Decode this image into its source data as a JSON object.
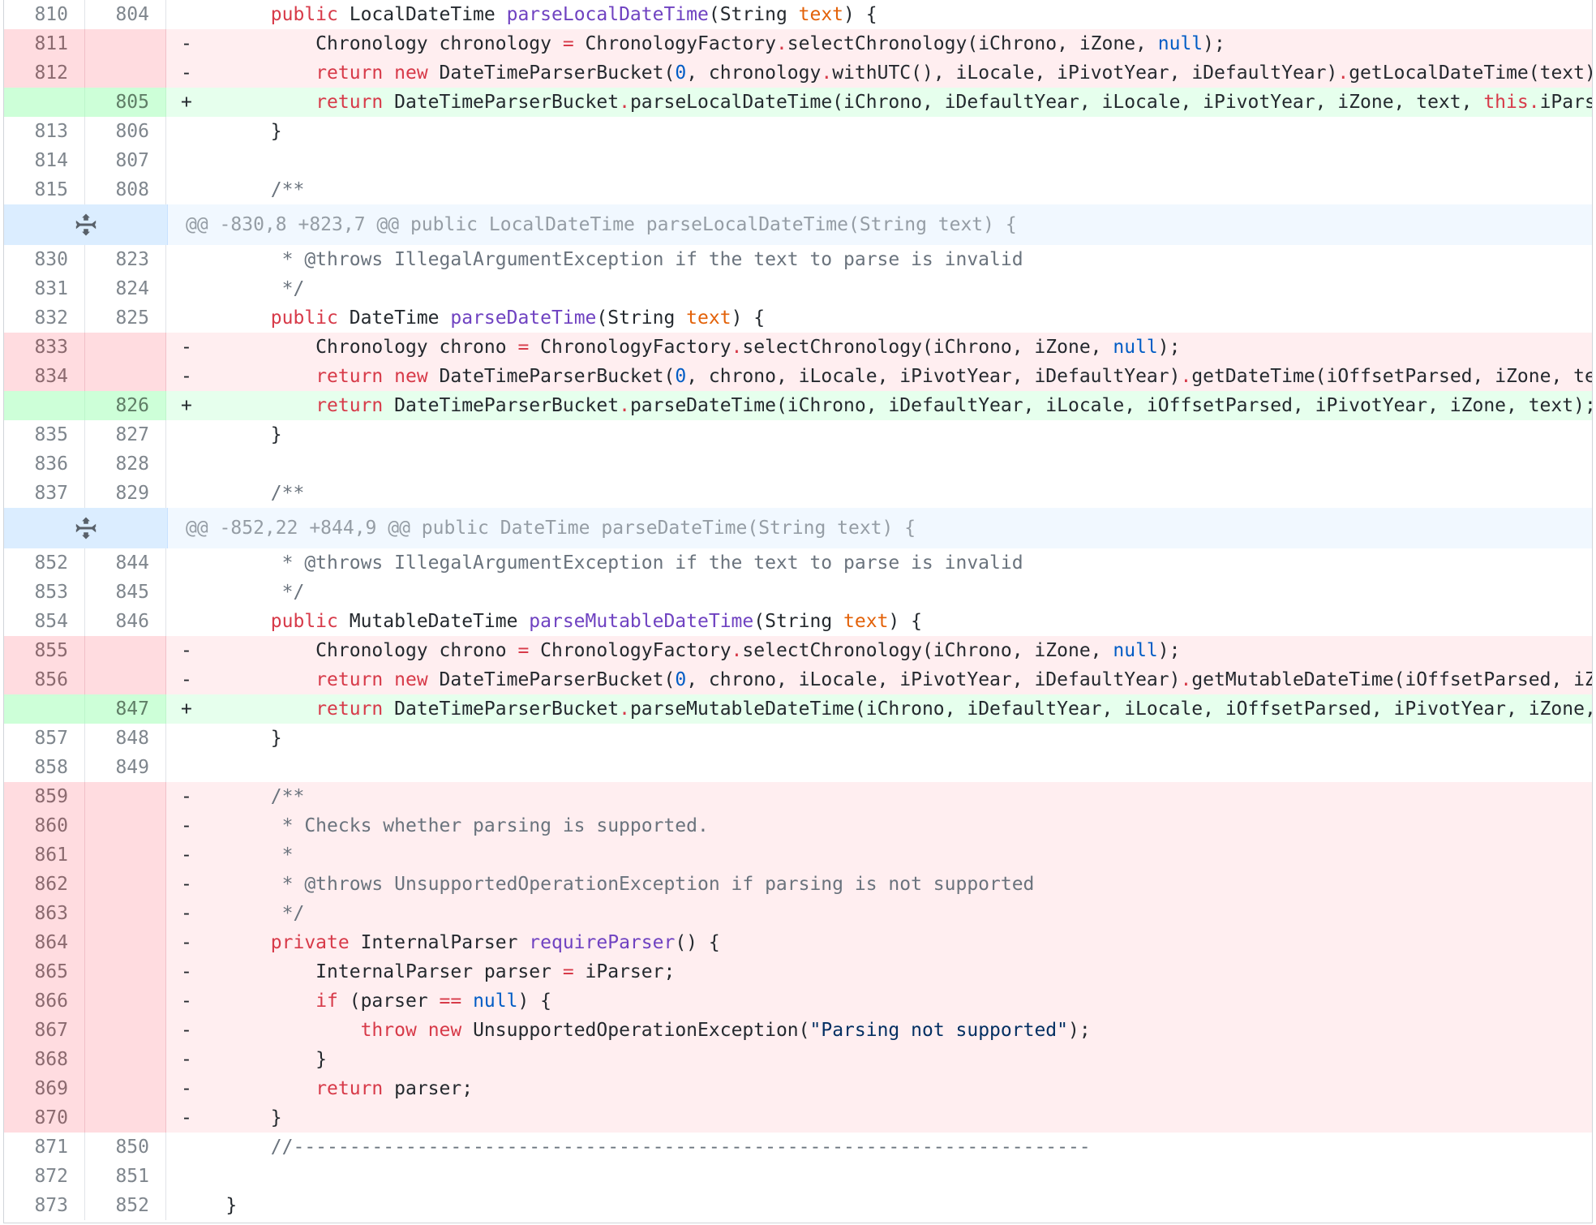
{
  "rows": [
    {
      "type": "ctx",
      "old": "810",
      "new": "804",
      "sign": " ",
      "tokens": [
        [
          "t",
          "    "
        ],
        [
          "k",
          "public"
        ],
        [
          "t",
          " LocalDateTime "
        ],
        [
          "f",
          "parseLocalDateTime"
        ],
        [
          "t",
          "(String "
        ],
        [
          "v",
          "text"
        ],
        [
          "t",
          ") {"
        ]
      ]
    },
    {
      "type": "del",
      "old": "811",
      "new": "",
      "sign": "-",
      "tokens": [
        [
          "t",
          "        Chronology chronology "
        ],
        [
          "k",
          "="
        ],
        [
          "t",
          " ChronologyFactory"
        ],
        [
          "k",
          "."
        ],
        [
          "t",
          "selectChronology(iChrono, iZone, "
        ],
        [
          "n",
          "null"
        ],
        [
          "t",
          ");"
        ]
      ]
    },
    {
      "type": "del",
      "old": "812",
      "new": "",
      "sign": "-",
      "tokens": [
        [
          "t",
          "        "
        ],
        [
          "k",
          "return"
        ],
        [
          "t",
          " "
        ],
        [
          "k",
          "new"
        ],
        [
          "t",
          " DateTimeParserBucket("
        ],
        [
          "n",
          "0"
        ],
        [
          "t",
          ", chronology"
        ],
        [
          "k",
          "."
        ],
        [
          "t",
          "withUTC(), iLocale, iPivotYear, iDefaultYear)"
        ],
        [
          "k",
          "."
        ],
        [
          "t",
          "getLocalDateTime(text);"
        ]
      ]
    },
    {
      "type": "add",
      "old": "",
      "new": "805",
      "sign": "+",
      "tokens": [
        [
          "t",
          "        "
        ],
        [
          "k",
          "return"
        ],
        [
          "t",
          " DateTimeParserBucket"
        ],
        [
          "k",
          "."
        ],
        [
          "t",
          "parseLocalDateTime(iChrono, iDefaultYear, iLocale, iPivotYear, iZone, text, "
        ],
        [
          "k",
          "this"
        ],
        [
          "k",
          "."
        ],
        [
          "t",
          "iParser);"
        ]
      ]
    },
    {
      "type": "ctx",
      "old": "813",
      "new": "806",
      "sign": " ",
      "tokens": [
        [
          "t",
          "    }"
        ]
      ]
    },
    {
      "type": "ctx",
      "old": "814",
      "new": "807",
      "sign": " ",
      "tokens": [
        [
          "t",
          ""
        ]
      ]
    },
    {
      "type": "ctx",
      "old": "815",
      "new": "808",
      "sign": " ",
      "tokens": [
        [
          "t",
          "    "
        ],
        [
          "c",
          "/**"
        ]
      ]
    },
    {
      "type": "hunk",
      "text": "@@ -830,8 +823,7 @@ public LocalDateTime parseLocalDateTime(String text) {"
    },
    {
      "type": "ctx",
      "old": "830",
      "new": "823",
      "sign": " ",
      "tokens": [
        [
          "c",
          "     * @throws IllegalArgumentException if the text to parse is invalid"
        ]
      ]
    },
    {
      "type": "ctx",
      "old": "831",
      "new": "824",
      "sign": " ",
      "tokens": [
        [
          "c",
          "     */"
        ]
      ]
    },
    {
      "type": "ctx",
      "old": "832",
      "new": "825",
      "sign": " ",
      "tokens": [
        [
          "t",
          "    "
        ],
        [
          "k",
          "public"
        ],
        [
          "t",
          " DateTime "
        ],
        [
          "f",
          "parseDateTime"
        ],
        [
          "t",
          "(String "
        ],
        [
          "v",
          "text"
        ],
        [
          "t",
          ") {"
        ]
      ]
    },
    {
      "type": "del",
      "old": "833",
      "new": "",
      "sign": "-",
      "tokens": [
        [
          "t",
          "        Chronology chrono "
        ],
        [
          "k",
          "="
        ],
        [
          "t",
          " ChronologyFactory"
        ],
        [
          "k",
          "."
        ],
        [
          "t",
          "selectChronology(iChrono, iZone, "
        ],
        [
          "n",
          "null"
        ],
        [
          "t",
          ");"
        ]
      ]
    },
    {
      "type": "del",
      "old": "834",
      "new": "",
      "sign": "-",
      "tokens": [
        [
          "t",
          "        "
        ],
        [
          "k",
          "return"
        ],
        [
          "t",
          " "
        ],
        [
          "k",
          "new"
        ],
        [
          "t",
          " DateTimeParserBucket("
        ],
        [
          "n",
          "0"
        ],
        [
          "t",
          ", chrono, iLocale, iPivotYear, iDefaultYear)"
        ],
        [
          "k",
          "."
        ],
        [
          "t",
          "getDateTime(iOffsetParsed, iZone, text);"
        ]
      ]
    },
    {
      "type": "add",
      "old": "",
      "new": "826",
      "sign": "+",
      "tokens": [
        [
          "t",
          "        "
        ],
        [
          "k",
          "return"
        ],
        [
          "t",
          " DateTimeParserBucket"
        ],
        [
          "k",
          "."
        ],
        [
          "t",
          "parseDateTime(iChrono, iDefaultYear, iLocale, iOffsetParsed, iPivotYear, iZone, text);"
        ]
      ]
    },
    {
      "type": "ctx",
      "old": "835",
      "new": "827",
      "sign": " ",
      "tokens": [
        [
          "t",
          "    }"
        ]
      ]
    },
    {
      "type": "ctx",
      "old": "836",
      "new": "828",
      "sign": " ",
      "tokens": [
        [
          "t",
          ""
        ]
      ]
    },
    {
      "type": "ctx",
      "old": "837",
      "new": "829",
      "sign": " ",
      "tokens": [
        [
          "t",
          "    "
        ],
        [
          "c",
          "/**"
        ]
      ]
    },
    {
      "type": "hunk",
      "text": "@@ -852,22 +844,9 @@ public DateTime parseDateTime(String text) {"
    },
    {
      "type": "ctx",
      "old": "852",
      "new": "844",
      "sign": " ",
      "tokens": [
        [
          "c",
          "     * @throws IllegalArgumentException if the text to parse is invalid"
        ]
      ]
    },
    {
      "type": "ctx",
      "old": "853",
      "new": "845",
      "sign": " ",
      "tokens": [
        [
          "c",
          "     */"
        ]
      ]
    },
    {
      "type": "ctx",
      "old": "854",
      "new": "846",
      "sign": " ",
      "tokens": [
        [
          "t",
          "    "
        ],
        [
          "k",
          "public"
        ],
        [
          "t",
          " MutableDateTime "
        ],
        [
          "f",
          "parseMutableDateTime"
        ],
        [
          "t",
          "(String "
        ],
        [
          "v",
          "text"
        ],
        [
          "t",
          ") {"
        ]
      ]
    },
    {
      "type": "del",
      "old": "855",
      "new": "",
      "sign": "-",
      "tokens": [
        [
          "t",
          "        Chronology chrono "
        ],
        [
          "k",
          "="
        ],
        [
          "t",
          " ChronologyFactory"
        ],
        [
          "k",
          "."
        ],
        [
          "t",
          "selectChronology(iChrono, iZone, "
        ],
        [
          "n",
          "null"
        ],
        [
          "t",
          ");"
        ]
      ]
    },
    {
      "type": "del",
      "old": "856",
      "new": "",
      "sign": "-",
      "tokens": [
        [
          "t",
          "        "
        ],
        [
          "k",
          "return"
        ],
        [
          "t",
          " "
        ],
        [
          "k",
          "new"
        ],
        [
          "t",
          " DateTimeParserBucket("
        ],
        [
          "n",
          "0"
        ],
        [
          "t",
          ", chrono, iLocale, iPivotYear, iDefaultYear)"
        ],
        [
          "k",
          "."
        ],
        [
          "t",
          "getMutableDateTime(iOffsetParsed, iZone, text);"
        ]
      ]
    },
    {
      "type": "add",
      "old": "",
      "new": "847",
      "sign": "+",
      "tokens": [
        [
          "t",
          "        "
        ],
        [
          "k",
          "return"
        ],
        [
          "t",
          " DateTimeParserBucket"
        ],
        [
          "k",
          "."
        ],
        [
          "t",
          "parseMutableDateTime(iChrono, iDefaultYear, iLocale, iOffsetParsed, iPivotYear, iZone, text);"
        ]
      ]
    },
    {
      "type": "ctx",
      "old": "857",
      "new": "848",
      "sign": " ",
      "tokens": [
        [
          "t",
          "    }"
        ]
      ]
    },
    {
      "type": "ctx",
      "old": "858",
      "new": "849",
      "sign": " ",
      "tokens": [
        [
          "t",
          ""
        ]
      ]
    },
    {
      "type": "del",
      "old": "859",
      "new": "",
      "sign": "-",
      "tokens": [
        [
          "t",
          "    "
        ],
        [
          "c",
          "/**"
        ]
      ]
    },
    {
      "type": "del",
      "old": "860",
      "new": "",
      "sign": "-",
      "tokens": [
        [
          "c",
          "     * Checks whether parsing is supported."
        ]
      ]
    },
    {
      "type": "del",
      "old": "861",
      "new": "",
      "sign": "-",
      "tokens": [
        [
          "c",
          "     *"
        ]
      ]
    },
    {
      "type": "del",
      "old": "862",
      "new": "",
      "sign": "-",
      "tokens": [
        [
          "c",
          "     * @throws UnsupportedOperationException if parsing is not supported"
        ]
      ]
    },
    {
      "type": "del",
      "old": "863",
      "new": "",
      "sign": "-",
      "tokens": [
        [
          "c",
          "     */"
        ]
      ]
    },
    {
      "type": "del",
      "old": "864",
      "new": "",
      "sign": "-",
      "tokens": [
        [
          "t",
          "    "
        ],
        [
          "k",
          "private"
        ],
        [
          "t",
          " InternalParser "
        ],
        [
          "f",
          "requireParser"
        ],
        [
          "t",
          "() {"
        ]
      ]
    },
    {
      "type": "del",
      "old": "865",
      "new": "",
      "sign": "-",
      "tokens": [
        [
          "t",
          "        InternalParser parser "
        ],
        [
          "k",
          "="
        ],
        [
          "t",
          " iParser;"
        ]
      ]
    },
    {
      "type": "del",
      "old": "866",
      "new": "",
      "sign": "-",
      "tokens": [
        [
          "t",
          "        "
        ],
        [
          "k",
          "if"
        ],
        [
          "t",
          " (parser "
        ],
        [
          "k",
          "=="
        ],
        [
          "t",
          " "
        ],
        [
          "n",
          "null"
        ],
        [
          "t",
          ") {"
        ]
      ]
    },
    {
      "type": "del",
      "old": "867",
      "new": "",
      "sign": "-",
      "tokens": [
        [
          "t",
          "            "
        ],
        [
          "k",
          "throw"
        ],
        [
          "t",
          " "
        ],
        [
          "k",
          "new"
        ],
        [
          "t",
          " UnsupportedOperationException("
        ],
        [
          "s",
          "\"Parsing not supported\""
        ],
        [
          "t",
          ");"
        ]
      ]
    },
    {
      "type": "del",
      "old": "868",
      "new": "",
      "sign": "-",
      "tokens": [
        [
          "t",
          "        }"
        ]
      ]
    },
    {
      "type": "del",
      "old": "869",
      "new": "",
      "sign": "-",
      "tokens": [
        [
          "t",
          "        "
        ],
        [
          "k",
          "return"
        ],
        [
          "t",
          " parser;"
        ]
      ]
    },
    {
      "type": "del",
      "old": "870",
      "new": "",
      "sign": "-",
      "tokens": [
        [
          "t",
          "    }"
        ]
      ]
    },
    {
      "type": "ctx",
      "old": "871",
      "new": "850",
      "sign": " ",
      "tokens": [
        [
          "t",
          "    "
        ],
        [
          "c",
          "//-----------------------------------------------------------------------"
        ]
      ]
    },
    {
      "type": "ctx",
      "old": "872",
      "new": "851",
      "sign": " ",
      "tokens": [
        [
          "t",
          ""
        ]
      ]
    },
    {
      "type": "ctx",
      "old": "873",
      "new": "852",
      "sign": " ",
      "tokens": [
        [
          "t",
          "}"
        ]
      ]
    }
  ],
  "icons": {
    "hunk_expand": "unfold-icon"
  }
}
